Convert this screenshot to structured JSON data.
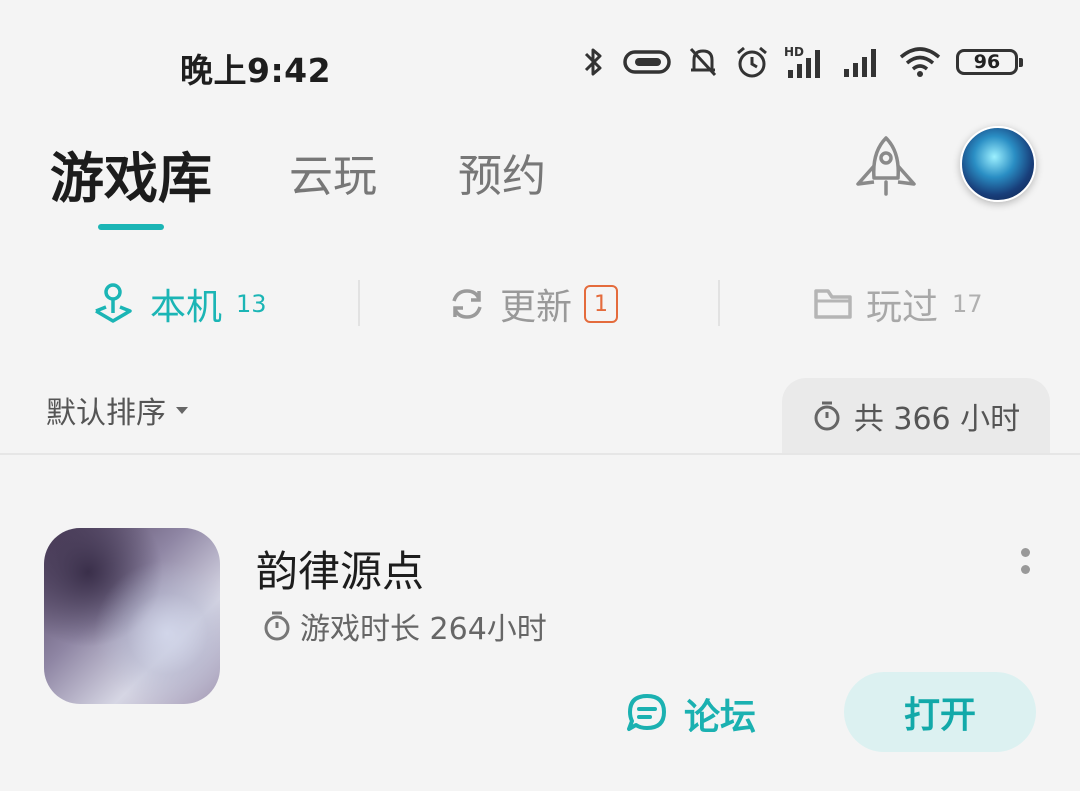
{
  "status_bar": {
    "time": "晚上9:42",
    "battery": "96",
    "icons": [
      "bluetooth-icon",
      "link-icon",
      "bell-off-icon",
      "alarm-icon",
      "hd-signal-icon",
      "signal-icon",
      "wifi-icon",
      "battery-icon"
    ]
  },
  "top_tabs": [
    {
      "label": "游戏库",
      "active": true
    },
    {
      "label": "云玩",
      "active": false
    },
    {
      "label": "预约",
      "active": false
    }
  ],
  "header_icons": [
    "rocket-icon",
    "avatar"
  ],
  "sub_tabs": [
    {
      "label": "本机",
      "count": "13",
      "icon": "local-device-icon",
      "color": "#1bb5b5"
    },
    {
      "label": "更新",
      "badge": "1",
      "icon": "refresh-icon",
      "color": "#999999"
    },
    {
      "label": "玩过",
      "count": "17",
      "icon": "folder-icon",
      "color": "#999999"
    }
  ],
  "sort": {
    "label": "默认排序"
  },
  "total_time": "共 366 小时",
  "games": [
    {
      "name": "韵律源点",
      "playtime": "游戏时长 264小时",
      "forum_label": "论坛",
      "open_label": "打开"
    }
  ],
  "colors": {
    "accent": "#1bb5b5",
    "badge": "#e46b3c",
    "open_bg": "#dcf1f1"
  }
}
